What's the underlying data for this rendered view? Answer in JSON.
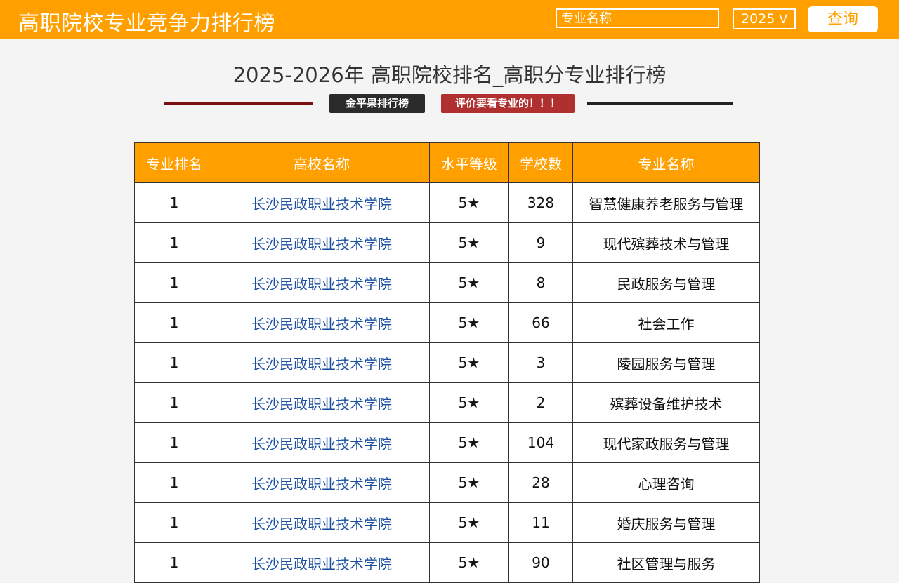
{
  "header": {
    "site_title": "高职院校专业竞争力排行榜",
    "search_placeholder": "专业名称",
    "year": "2025",
    "year_chevron": "V",
    "query_label": "查询"
  },
  "main": {
    "heading": "2025-2026年 高职院校排名_高职分专业排行榜",
    "badge_left": "金平果排行榜",
    "badge_right": "评价要看专业的！！！"
  },
  "table": {
    "headers": [
      "专业排名",
      "高校名称",
      "水平等级",
      "学校数",
      "专业名称"
    ],
    "rows": [
      {
        "rank": "1",
        "school": "长沙民政职业技术学院",
        "level": "5★",
        "count": "328",
        "major": "智慧健康养老服务与管理"
      },
      {
        "rank": "1",
        "school": "长沙民政职业技术学院",
        "level": "5★",
        "count": "9",
        "major": "现代殡葬技术与管理"
      },
      {
        "rank": "1",
        "school": "长沙民政职业技术学院",
        "level": "5★",
        "count": "8",
        "major": "民政服务与管理"
      },
      {
        "rank": "1",
        "school": "长沙民政职业技术学院",
        "level": "5★",
        "count": "66",
        "major": "社会工作"
      },
      {
        "rank": "1",
        "school": "长沙民政职业技术学院",
        "level": "5★",
        "count": "3",
        "major": "陵园服务与管理"
      },
      {
        "rank": "1",
        "school": "长沙民政职业技术学院",
        "level": "5★",
        "count": "2",
        "major": "殡葬设备维护技术"
      },
      {
        "rank": "1",
        "school": "长沙民政职业技术学院",
        "level": "5★",
        "count": "104",
        "major": "现代家政服务与管理"
      },
      {
        "rank": "1",
        "school": "长沙民政职业技术学院",
        "level": "5★",
        "count": "28",
        "major": "心理咨询"
      },
      {
        "rank": "1",
        "school": "长沙民政职业技术学院",
        "level": "5★",
        "count": "11",
        "major": "婚庆服务与管理"
      },
      {
        "rank": "1",
        "school": "长沙民政职业技术学院",
        "level": "5★",
        "count": "90",
        "major": "社区管理与服务"
      }
    ]
  },
  "colors": {
    "accent": "#ffa000",
    "link": "#1a4fa0",
    "badge_dark": "#2b2b2b",
    "badge_red": "#b03030"
  }
}
